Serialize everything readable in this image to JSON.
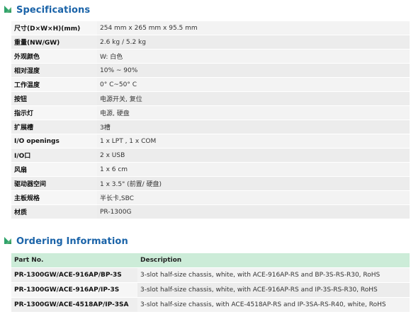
{
  "specifications": {
    "title": "Specifications",
    "rows": [
      {
        "label": "尺寸(D×W×H)(mm)",
        "value": "254 mm x 265 mm x 95.5 mm"
      },
      {
        "label": "重量(NW/GW)",
        "value": "2.6 kg / 5.2 kg"
      },
      {
        "label": "外观颜色",
        "value": "W: 白色"
      },
      {
        "label": "相对湿度",
        "value": "10% ~ 90%"
      },
      {
        "label": "工作温度",
        "value": "0° C~50° C"
      },
      {
        "label": "按钮",
        "value": "电源开关, 复位"
      },
      {
        "label": "指示灯",
        "value": "电源, 硬盘"
      },
      {
        "label": "扩展槽",
        "value": "3槽"
      },
      {
        "label": "I/O openings",
        "value": "1 x LPT , 1 x COM"
      },
      {
        "label": "I/O口",
        "value": "2 x USB"
      },
      {
        "label": "风扇",
        "value": "1 x 6 cm"
      },
      {
        "label": "驱动器空间",
        "value": "1 x 3.5\" (前置/ 硬盘)"
      },
      {
        "label": "主板规格",
        "value": "半长卡,SBC"
      },
      {
        "label": "材质",
        "value": "PR-1300G"
      }
    ]
  },
  "ordering": {
    "title": "Ordering Information",
    "headers": {
      "part_no": "Part No.",
      "description": "Description"
    },
    "rows": [
      {
        "part_no": "PR-1300GW/ACE-916AP/BP-3S",
        "description": "3-slot half-size chassis, white, with ACE-916AP-RS and BP-3S-RS-R30, RoHS"
      },
      {
        "part_no": "PR-1300GW/ACE-916AP/IP-3S",
        "description": "3-slot half-size chassis, white, with ACE-916AP-RS and IP-3S-RS-R30, RoHS"
      },
      {
        "part_no": "PR-1300GW/ACE-4518AP/IP-3SA",
        "description": "3-slot half-size chassis, with ACE-4518AP-RS and IP-3SA-RS-R40, white, RoHS"
      }
    ]
  },
  "colors": {
    "title": "#1a63a8",
    "bullet": "#2fa36b",
    "header_row": "#ccecd8"
  }
}
